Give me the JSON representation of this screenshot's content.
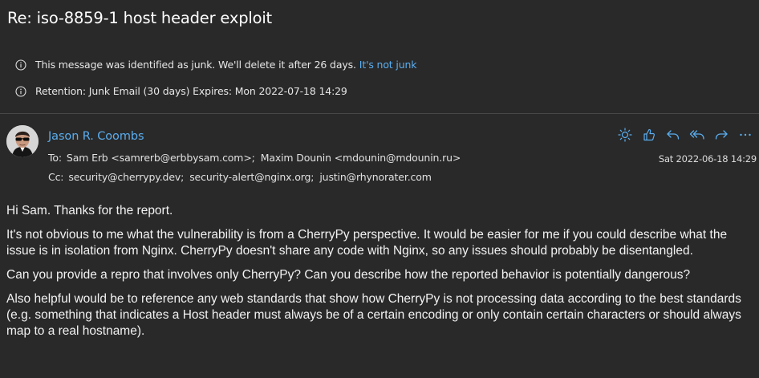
{
  "message": {
    "subject": "Re: iso-8859-1 host header exploit",
    "junk_notice": "This message was identified as junk. We'll delete it after 26 days.",
    "not_junk_link": "It's not junk",
    "retention_notice": "Retention: Junk Email (30 days) Expires: Mon 2022-07-18 14:29",
    "sender_name": "Jason R. Coombs",
    "to_label": "To:",
    "to": [
      "Sam Erb <samrerb@erbbysam.com>;",
      "Maxim Dounin <mdounin@mdounin.ru>"
    ],
    "cc_label": "Cc:",
    "cc": [
      "security@cherrypy.dev;",
      "security-alert@nginx.org;",
      "justin@rhynorater.com"
    ],
    "date": "Sat 2022-06-18 14:29",
    "body": [
      "Hi Sam. Thanks for the report.",
      "It's not obvious to me what the vulnerability is from a CherryPy perspective. It would be easier for me if you could describe what the issue is in isolation from Nginx. CherryPy doesn't share any code with Nginx, so any issues should probably be disentangled.",
      "Can you provide a repro that involves only CherryPy? Can you describe how the reported behavior is potentially dangerous?",
      "Also helpful would be to reference any web standards that show how CherryPy is not processing data according to the best standards (e.g. something that indicates a Host header must always be of a certain encoding or only contain certain characters or should always map to a real hostname)."
    ]
  },
  "toolbar": {
    "icons": [
      "sun-icon",
      "thumbs-up-icon",
      "reply-icon",
      "reply-all-icon",
      "forward-icon",
      "more-icon"
    ]
  },
  "colors": {
    "background": "#292929",
    "link": "#5aaef0",
    "text": "#f0f0f0"
  }
}
